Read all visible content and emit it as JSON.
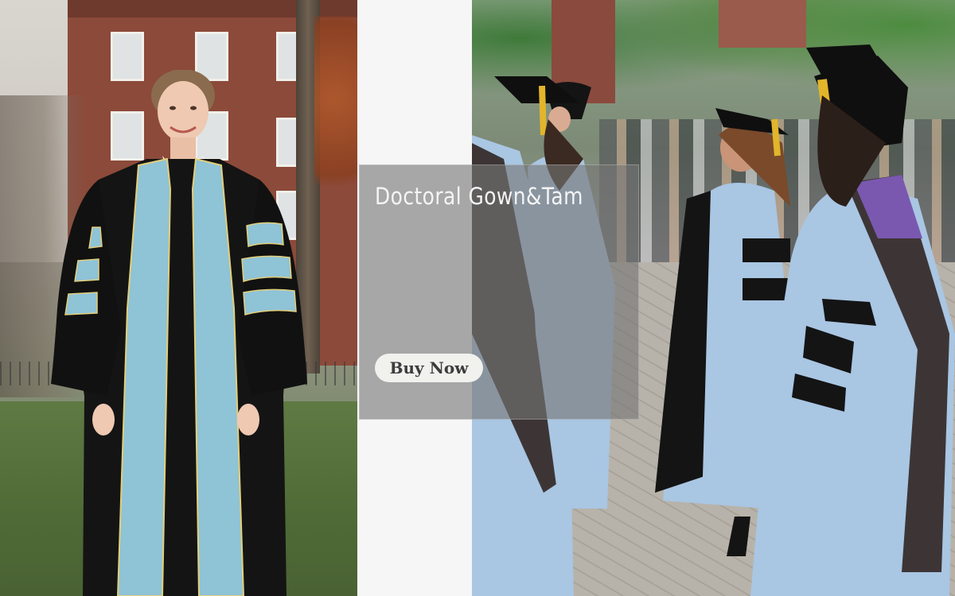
{
  "banner": {
    "title": "Doctoral Gown&Tam",
    "cta_label": "Buy Now"
  },
  "colors": {
    "gown_black": "#141414",
    "velvet_blue": "#8fc3d6",
    "gown_light_blue": "#a9c6e3",
    "hood_purple": "#7a58b0",
    "tassel_gold": "#e2b52b",
    "overlay": "#767676",
    "button_bg": "#f1f1ee",
    "button_text": "#3c3c3c"
  },
  "images": {
    "left": "model-in-black-doctoral-gown-with-light-blue-velvet-panels",
    "right": "graduates-in-light-blue-doctoral-gowns-and-tams"
  }
}
